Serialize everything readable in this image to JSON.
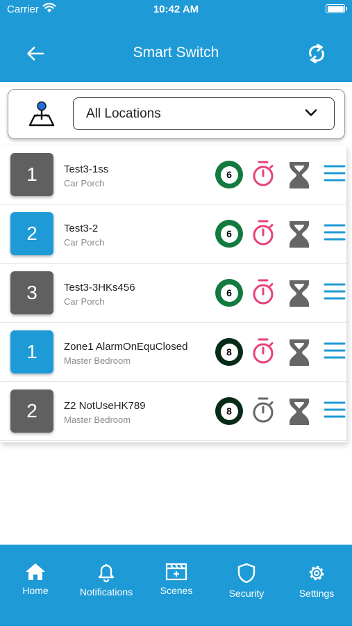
{
  "status_bar": {
    "carrier": "Carrier",
    "time": "10:42 AM"
  },
  "header": {
    "title": "Smart Switch"
  },
  "filter": {
    "selected_location": "All Locations"
  },
  "switches": [
    {
      "number": "1",
      "tile_color": "gray",
      "name": "Test3-1ss",
      "location": "Car Porch",
      "badge_value": "6",
      "badge_color": "green",
      "timer_color": "#e9417b"
    },
    {
      "number": "2",
      "tile_color": "blue",
      "name": "Test3-2",
      "location": "Car Porch",
      "badge_value": "6",
      "badge_color": "green",
      "timer_color": "#e9417b"
    },
    {
      "number": "3",
      "tile_color": "gray",
      "name": "Test3-3HKs456",
      "location": "Car Porch",
      "badge_value": "6",
      "badge_color": "green",
      "timer_color": "#e9417b"
    },
    {
      "number": "1",
      "tile_color": "blue",
      "name": "Zone1 AlarmOnEquClosed",
      "location": "Master Bedroom",
      "badge_value": "8",
      "badge_color": "dark",
      "timer_color": "#e9417b"
    },
    {
      "number": "2",
      "tile_color": "gray",
      "name": "Z2 NotUseHK789",
      "location": "Master Bedroom",
      "badge_value": "8",
      "badge_color": "dark",
      "timer_color": "#666666"
    }
  ],
  "tabs": [
    {
      "label": "Home",
      "icon": "home-icon"
    },
    {
      "label": "Notifications",
      "icon": "bell-icon"
    },
    {
      "label": "Scenes",
      "icon": "scenes-icon"
    },
    {
      "label": "Security",
      "icon": "shield-icon"
    },
    {
      "label": "Settings",
      "icon": "gear-icon"
    }
  ],
  "colors": {
    "primary": "#1e9ad6",
    "tile_gray": "#606060",
    "badge_green": "#127a3e",
    "badge_dark": "#062b17",
    "hourglass": "#666666"
  }
}
